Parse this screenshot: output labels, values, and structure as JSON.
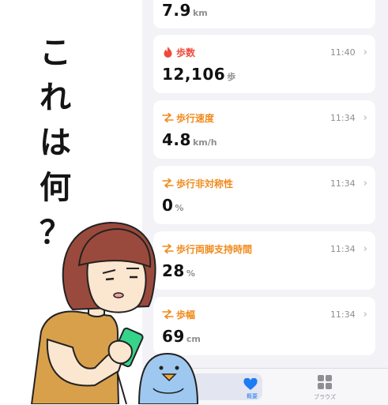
{
  "caption_chars": [
    "こ",
    "れ",
    "は",
    "何",
    "？"
  ],
  "top_card": {
    "value": "7.9",
    "unit": "km"
  },
  "cards": [
    {
      "title": "歩数",
      "time": "11:40",
      "value": "12,106",
      "unit": "歩",
      "icon": "flame-icon",
      "title_color": "#ef4b3b"
    },
    {
      "title": "歩行速度",
      "time": "11:34",
      "value": "4.8",
      "unit": "km/h",
      "icon": "walking-arrows-icon",
      "title_color": "#f08a1c"
    },
    {
      "title": "歩行非対称性",
      "time": "11:34",
      "value": "0",
      "unit": "%",
      "icon": "walking-arrows-icon",
      "title_color": "#f08a1c"
    },
    {
      "title": "歩行両脚支持時間",
      "time": "11:34",
      "value": "28",
      "unit": "%",
      "icon": "walking-arrows-icon",
      "title_color": "#f08a1c"
    },
    {
      "title": "歩幅",
      "time": "11:34",
      "value": "69",
      "unit": "cm",
      "icon": "walking-arrows-icon",
      "title_color": "#f08a1c"
    }
  ],
  "tabbar": {
    "summary_label": "概要",
    "summary_icon": "heart-icon",
    "browse_label": "ブラウズ",
    "browse_icon": "grid-icon"
  },
  "colors": {
    "accent": "#f08a1c",
    "steps": "#ef4b3b",
    "tab_active": "#1e7cf2"
  }
}
